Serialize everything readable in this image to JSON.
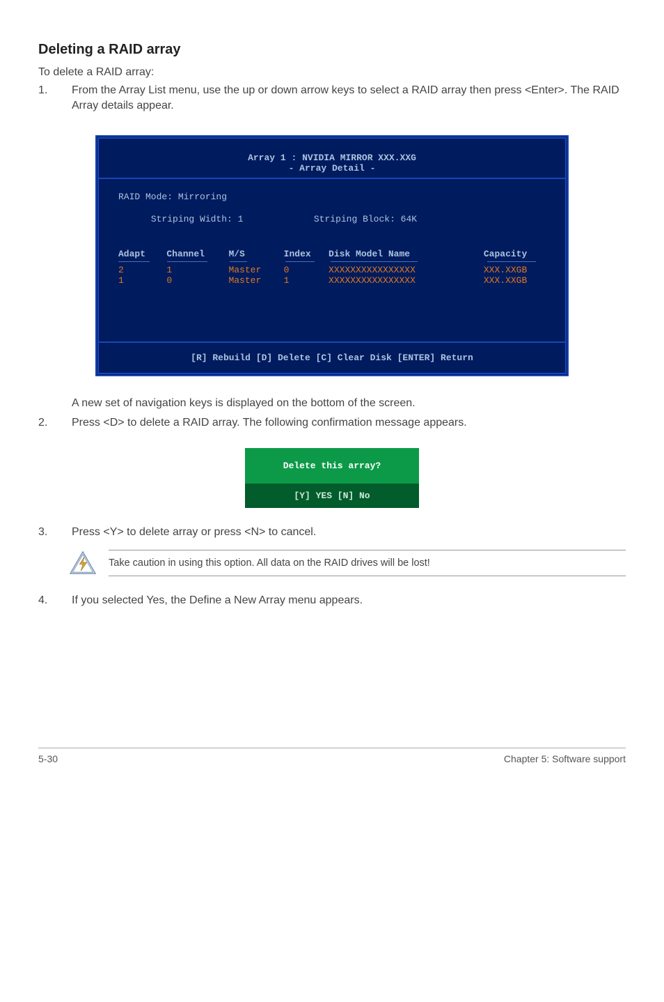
{
  "heading": "Deleting a RAID array",
  "intro": "To delete a RAID array:",
  "step1_num": "1.",
  "step1_text": "From the Array List menu, use the up or down arrow keys to select a RAID array then press <Enter>. The RAID Array details appear.",
  "terminal": {
    "title_line1": "Array 1 : NVIDIA MIRROR  XXX.XXG",
    "title_line2": "- Array Detail -",
    "raid_mode": "RAID Mode: Mirroring",
    "striping_width": "Striping Width: 1",
    "striping_block": "Striping Block: 64K",
    "header": {
      "adapt": "Adapt",
      "channel": "Channel",
      "ms": "M/S",
      "index": "Index",
      "model": "Disk Model Name",
      "capacity": "Capacity"
    },
    "rows": [
      {
        "adapt": "2",
        "channel": "1",
        "ms": "Master",
        "index": "0",
        "model": "XXXXXXXXXXXXXXXX",
        "capacity": "XXX.XXGB"
      },
      {
        "adapt": "1",
        "channel": "0",
        "ms": "Master",
        "index": "1",
        "model": "XXXXXXXXXXXXXXXX",
        "capacity": "XXX.XXGB"
      }
    ],
    "footer": "[R] Rebuild  [D] Delete  [C] Clear Disk  [ENTER] Return"
  },
  "between_line1": "A new set of  navigation keys is displayed on the bottom of the screen.",
  "step2_num": "2.",
  "step2_text": "Press <D> to delete a RAID array. The following confirmation message appears.",
  "dialog": {
    "question": "Delete this array?",
    "options": "[Y] YES   [N] No"
  },
  "step3_num": "3.",
  "step3_text": "Press <Y> to delete array or press <N> to cancel.",
  "warning_text": "Take caution in using this option. All data on the RAID drives will be lost!",
  "step4_num": "4.",
  "step4_text": "If you selected Yes, the Define a New Array menu appears.",
  "footer_left": "5-30",
  "footer_right": "Chapter 5: Software support"
}
